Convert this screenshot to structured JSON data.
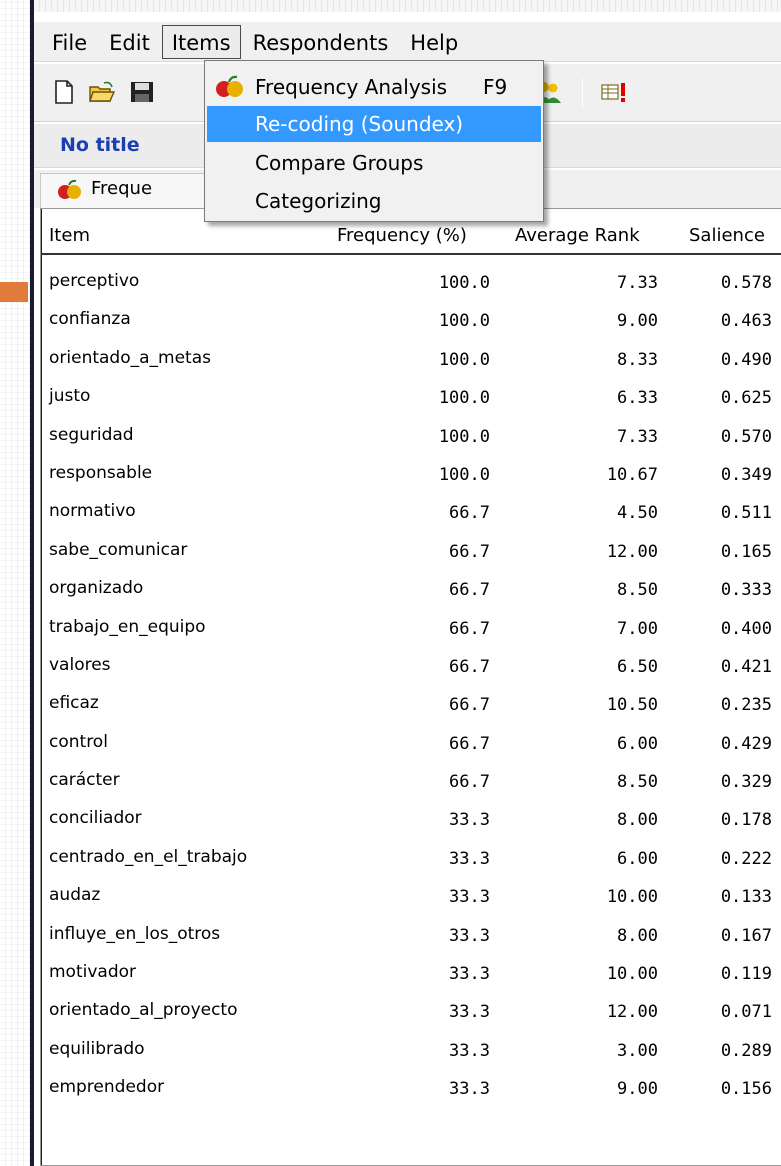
{
  "menubar": {
    "items": [
      {
        "label": "File"
      },
      {
        "label": "Edit"
      },
      {
        "label": "Items"
      },
      {
        "label": "Respondents"
      },
      {
        "label": "Help"
      }
    ],
    "active": "Items"
  },
  "toolbar": {
    "icons": [
      "new-document-icon",
      "open-folder-icon",
      "save-icon",
      "respondents-icon",
      "table-alert-icon"
    ]
  },
  "document": {
    "title": "No title"
  },
  "tab": {
    "label": "Freque"
  },
  "items_menu": {
    "items": [
      {
        "label": "Frequency Analysis",
        "shortcut": "F9",
        "icon": "apples-icon"
      },
      {
        "label": "Re-coding (Soundex)",
        "shortcut": "",
        "highlighted": true
      },
      {
        "label": "Compare Groups",
        "shortcut": ""
      },
      {
        "label": "Categorizing",
        "shortcut": ""
      }
    ]
  },
  "table": {
    "headers": {
      "item": "Item",
      "frequency": "Frequency (%)",
      "rank": "Average Rank",
      "salience": "Salience"
    },
    "rows": [
      {
        "item": "perceptivo",
        "frequency": "100.0",
        "rank": "7.33",
        "salience": "0.578"
      },
      {
        "item": "confianza",
        "frequency": "100.0",
        "rank": "9.00",
        "salience": "0.463"
      },
      {
        "item": "orientado_a_metas",
        "frequency": "100.0",
        "rank": "8.33",
        "salience": "0.490"
      },
      {
        "item": "justo",
        "frequency": "100.0",
        "rank": "6.33",
        "salience": "0.625"
      },
      {
        "item": "seguridad",
        "frequency": "100.0",
        "rank": "7.33",
        "salience": "0.570"
      },
      {
        "item": "responsable",
        "frequency": "100.0",
        "rank": "10.67",
        "salience": "0.349"
      },
      {
        "item": "normativo",
        "frequency": "66.7",
        "rank": "4.50",
        "salience": "0.511"
      },
      {
        "item": "sabe_comunicar",
        "frequency": "66.7",
        "rank": "12.00",
        "salience": "0.165"
      },
      {
        "item": "organizado",
        "frequency": "66.7",
        "rank": "8.50",
        "salience": "0.333"
      },
      {
        "item": "trabajo_en_equipo",
        "frequency": "66.7",
        "rank": "7.00",
        "salience": "0.400"
      },
      {
        "item": "valores",
        "frequency": "66.7",
        "rank": "6.50",
        "salience": "0.421"
      },
      {
        "item": "eficaz",
        "frequency": "66.7",
        "rank": "10.50",
        "salience": "0.235"
      },
      {
        "item": "control",
        "frequency": "66.7",
        "rank": "6.00",
        "salience": "0.429"
      },
      {
        "item": "carácter",
        "frequency": "66.7",
        "rank": "8.50",
        "salience": "0.329"
      },
      {
        "item": "conciliador",
        "frequency": "33.3",
        "rank": "8.00",
        "salience": "0.178"
      },
      {
        "item": "centrado_en_el_trabajo",
        "frequency": "33.3",
        "rank": "6.00",
        "salience": "0.222"
      },
      {
        "item": "audaz",
        "frequency": "33.3",
        "rank": "10.00",
        "salience": "0.133"
      },
      {
        "item": "influye_en_los_otros",
        "frequency": "33.3",
        "rank": "8.00",
        "salience": "0.167"
      },
      {
        "item": "motivador",
        "frequency": "33.3",
        "rank": "10.00",
        "salience": "0.119"
      },
      {
        "item": "orientado_al_proyecto",
        "frequency": "33.3",
        "rank": "12.00",
        "salience": "0.071"
      },
      {
        "item": "equilibrado",
        "frequency": "33.3",
        "rank": "3.00",
        "salience": "0.289"
      },
      {
        "item": "emprendedor",
        "frequency": "33.3",
        "rank": "9.00",
        "salience": "0.156"
      }
    ]
  },
  "colors": {
    "doc_title": "#1a3fb0",
    "highlight": "#3399ff",
    "bullet": "#e07b39"
  }
}
